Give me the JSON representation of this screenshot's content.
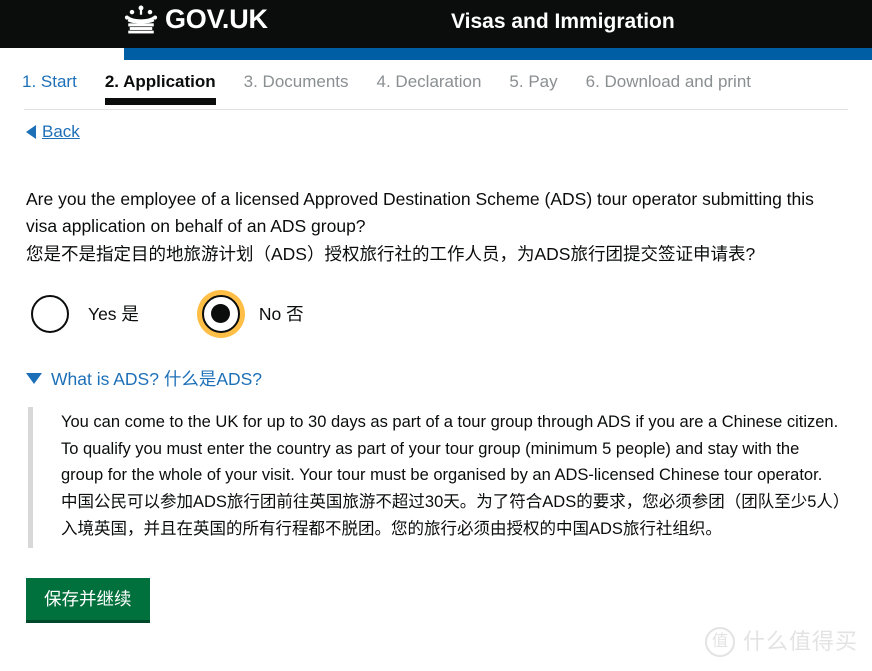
{
  "header": {
    "brand": "GOV.UK",
    "crown_icon": "crown-icon",
    "service_title": "Visas and Immigration"
  },
  "phase_nav": {
    "tabs": [
      {
        "label": "1. Start",
        "state": "link"
      },
      {
        "label": "2. Application",
        "state": "active"
      },
      {
        "label": "3. Documents",
        "state": "muted"
      },
      {
        "label": "4. Declaration",
        "state": "muted"
      },
      {
        "label": "5. Pay",
        "state": "muted"
      },
      {
        "label": "6. Download and print",
        "state": "muted"
      }
    ]
  },
  "back": {
    "label": "Back",
    "arrow_icon": "triangle-left-icon"
  },
  "question": {
    "en": "Are you the employee of a licensed Approved Destination Scheme (ADS) tour operator submitting this visa application on behalf of an ADS group?",
    "zh": "您是不是指定目的地旅游计划（ADS）授权旅行社的工作人员，为ADS旅行团提交签证申请表?"
  },
  "radios": [
    {
      "label": "Yes 是",
      "selected": false,
      "focused": false
    },
    {
      "label": "No 否",
      "selected": true,
      "focused": true
    }
  ],
  "details": {
    "summary": "What is ADS? 什么是ADS?",
    "triangle_icon": "triangle-down-icon",
    "expanded": true,
    "body_en": "You can come to the UK for up to 30 days as part of a tour group through ADS if you are a Chinese citizen. To qualify you must enter the country as part of your tour group (minimum 5 people) and stay with the group for the whole of your visit. Your tour must be organised by an ADS-licensed Chinese tour operator.",
    "body_zh": "中国公民可以参加ADS旅行团前往英国旅游不超过30天。为了符合ADS的要求，您必须参团（团队至少5人）入境英国，并且在英国的所有行程都不脱团。您的旅行必须由授权的中国ADS旅行社组织。"
  },
  "submit": {
    "label": "保存并继续"
  },
  "watermark": {
    "logo": "值",
    "text": "什么值得买"
  },
  "colors": {
    "header_black": "#0b0c0c",
    "accent_blue": "#005ea5",
    "link_blue": "#1d70b8",
    "focus_yellow": "#ffbf47",
    "button_green": "#00703c",
    "muted_grey": "#8a8f91"
  }
}
